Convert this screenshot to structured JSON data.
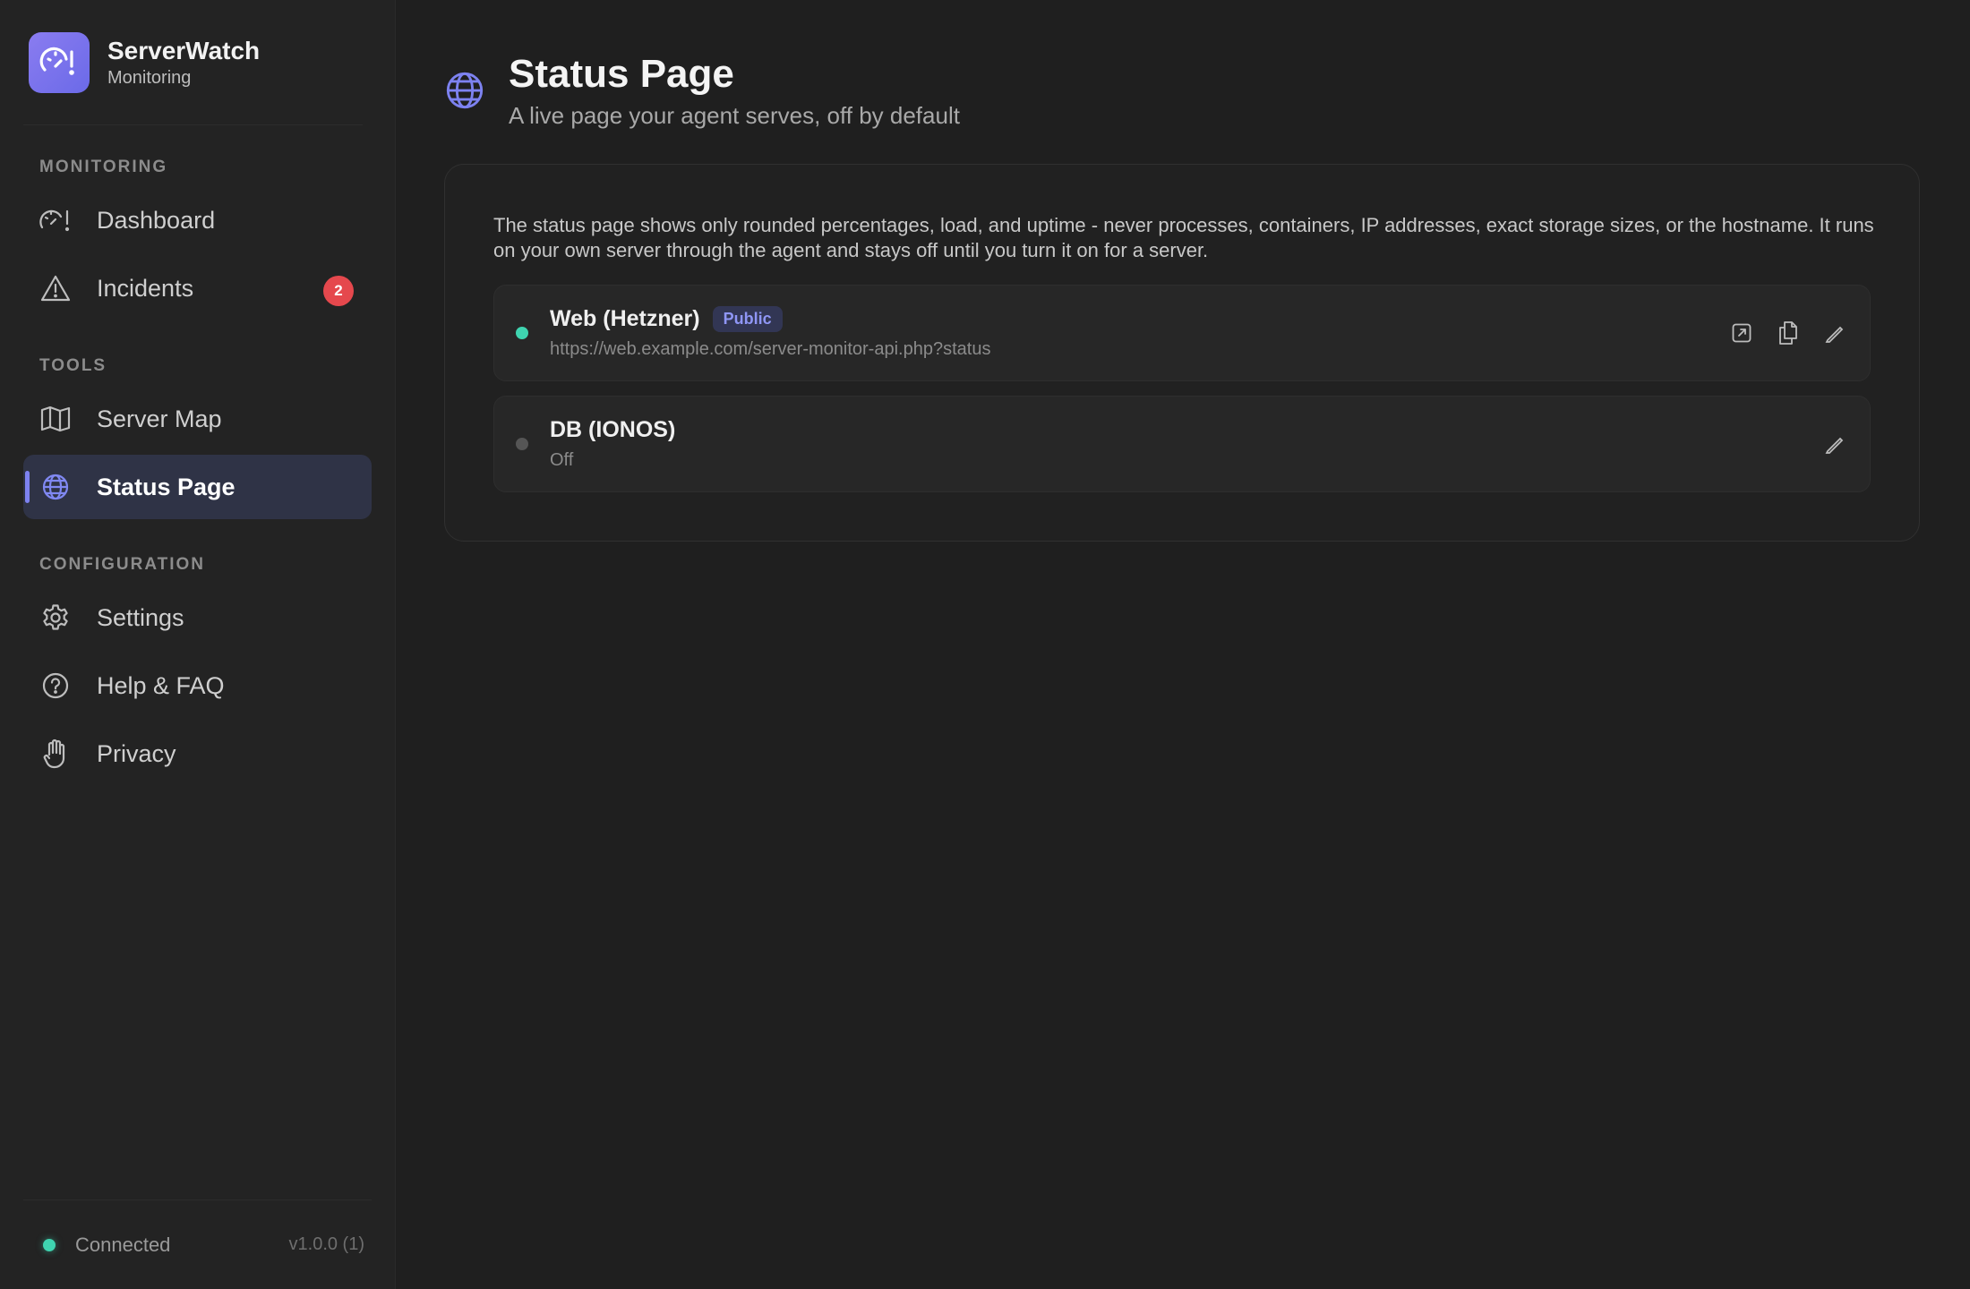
{
  "brand": {
    "name": "ServerWatch",
    "subtitle": "Monitoring"
  },
  "sidebar": {
    "sections": [
      {
        "label": "MONITORING"
      },
      {
        "label": "TOOLS"
      },
      {
        "label": "CONFIGURATION"
      }
    ],
    "items": [
      {
        "label": "Dashboard",
        "icon": "gauge-icon"
      },
      {
        "label": "Incidents",
        "icon": "warning-icon",
        "badge": "2"
      },
      {
        "label": "Server Map",
        "icon": "map-icon"
      },
      {
        "label": "Status Page",
        "icon": "globe-icon",
        "active": true
      },
      {
        "label": "Settings",
        "icon": "gear-icon"
      },
      {
        "label": "Help & FAQ",
        "icon": "question-icon"
      },
      {
        "label": "Privacy",
        "icon": "hand-icon"
      }
    ],
    "footer": {
      "status": "Connected",
      "version": "v1.0.0 (1)"
    }
  },
  "page": {
    "title": "Status Page",
    "subtitle": "A live page your agent serves, off by default",
    "info": "The status page shows only rounded percentages, load, and uptime - never processes, containers, IP addresses, exact storage sizes, or the hostname. It runs on your own server through the agent and stays off until you turn it on for a server."
  },
  "servers": [
    {
      "name": "Web (Hetzner)",
      "badge": "Public",
      "detail": "https://web.example.com/server-monitor-api.php?status",
      "status": "on"
    },
    {
      "name": "DB (IONOS)",
      "detail": "Off",
      "status": "off"
    }
  ],
  "colors": {
    "accent": "#7d82f0",
    "online": "#3fd4b0",
    "offline": "#555555",
    "badge_red": "#e5484d"
  }
}
